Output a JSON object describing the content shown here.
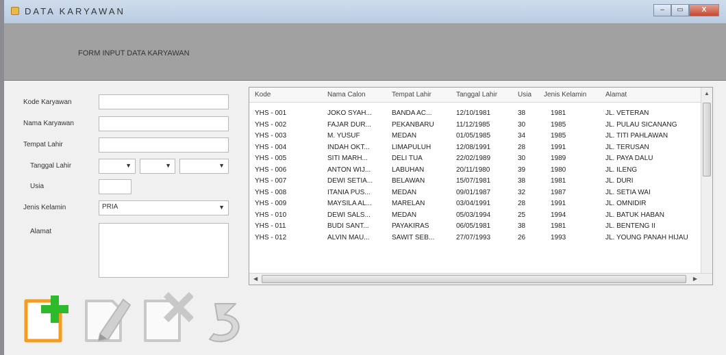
{
  "window": {
    "title": "DATA KARYAWAN",
    "controls": [
      "–",
      "▭",
      "X"
    ]
  },
  "header": {
    "title": "FORM INPUT DATA KARYAWAN"
  },
  "form": {
    "kode_label": "Kode Karyawan",
    "kode_value": "",
    "nama_label": "Nama Karyawan",
    "nama_value": "",
    "tempat_label": "Tempat Lahir",
    "tempat_value": "",
    "tanggal_label": "Tanggal Lahir",
    "tanggal_day": "",
    "tanggal_month": "",
    "tanggal_year": "",
    "usia_label": "Usia",
    "usia_value": "",
    "jk_label": "Jenis Kelamin",
    "jk_value": "PRIA",
    "alamat_label": "Alamat",
    "alamat_value": ""
  },
  "grid": {
    "columns": [
      "Kode",
      "Nama Calon",
      "Tempat Lahir",
      "Tanggal Lahir",
      "Usia",
      "Jenis Kelamin",
      "Alamat"
    ],
    "rows": [
      [
        "YHS - 001",
        "JOKO SYAH...",
        "BANDA AC...",
        "12/10/1981",
        "38",
        "1981",
        "JL. VETERAN"
      ],
      [
        "YHS - 002",
        "FAJAR DUR...",
        "PEKANBARU",
        "11/12/1985",
        "30",
        "1985",
        "JL. PULAU SICANANG"
      ],
      [
        "YHS - 003",
        "M. YUSUF",
        "MEDAN",
        "01/05/1985",
        "34",
        "1985",
        "JL. TITI PAHLAWAN"
      ],
      [
        "YHS - 004",
        "INDAH OKT...",
        "LIMAPULUH",
        "12/08/1991",
        "28",
        "1991",
        "JL. TERUSAN"
      ],
      [
        "YHS - 005",
        "SITI MARH...",
        "DELI TUA",
        "22/02/1989",
        "30",
        "1989",
        "JL. PAYA DALU"
      ],
      [
        "YHS - 006",
        "ANTON WIJ...",
        "LABUHAN",
        "20/11/1980",
        "39",
        "1980",
        "JL. ILENG"
      ],
      [
        "YHS - 007",
        "DEWI SETIA...",
        "BELAWAN",
        "15/07/1981",
        "38",
        "1981",
        "JL. DURI"
      ],
      [
        "YHS - 008",
        "ITANIA PUS...",
        "MEDAN",
        "09/01/1987",
        "32",
        "1987",
        "JL. SETIA WAI"
      ],
      [
        "YHS - 009",
        "MAYSILA AL...",
        "MARELAN",
        "03/04/1991",
        "28",
        "1991",
        "JL. OMNIDIR"
      ],
      [
        "YHS - 010",
        "DEWI SALS...",
        "MEDAN",
        "05/03/1994",
        "25",
        "1994",
        "JL. BATUK HABAN"
      ],
      [
        "YHS - 011",
        "BUDI SANT...",
        "PAYAKIRAS",
        "06/05/1981",
        "38",
        "1981",
        "JL. BENTENG II"
      ],
      [
        "YHS - 012",
        "ALVIN MAU...",
        "SAWIT SEB...",
        "27/07/1993",
        "26",
        "1993",
        "JL. YOUNG PANAH HIJAU"
      ]
    ]
  },
  "toolbar": {
    "add_icon": "add-document-icon",
    "edit_icon": "edit-pencil-icon",
    "delete_icon": "delete-document-icon",
    "undo_icon": "undo-arrow-icon"
  },
  "colors": {
    "add_orange": "#f39c1e",
    "add_green": "#2dbb2d",
    "disabled_gray": "#c8c8c8",
    "header_gray": "#a1a1a1"
  }
}
